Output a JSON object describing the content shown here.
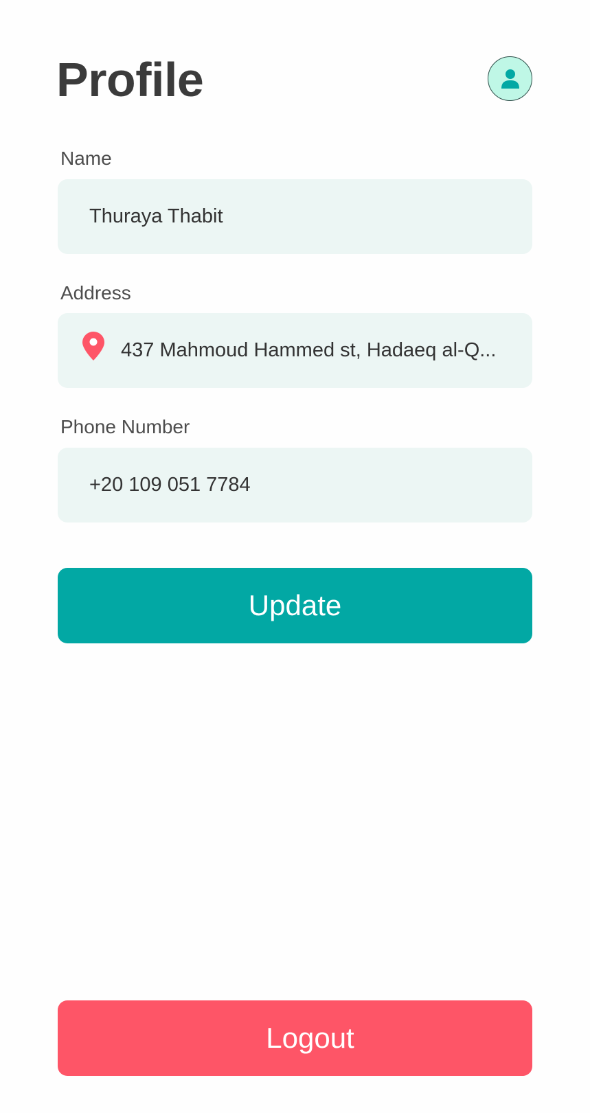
{
  "header": {
    "title": "Profile",
    "avatar_icon": "user-icon",
    "avatar_bg": "#bff7e6",
    "avatar_icon_color": "#02a8a4"
  },
  "form": {
    "name": {
      "label": "Name",
      "value": "Thuraya Thabit"
    },
    "address": {
      "label": "Address",
      "icon": "map-pin-icon",
      "icon_color": "#fe5567",
      "value": "437 Mahmoud Hammed st, Hadaeq al-Q..."
    },
    "phone": {
      "label": "Phone Number",
      "value": "+20 109 051 7784"
    },
    "field_bg": "#ecf6f4"
  },
  "actions": {
    "update_label": "Update",
    "update_color": "#02a8a4",
    "logout_label": "Logout",
    "logout_color": "#fe5567"
  }
}
